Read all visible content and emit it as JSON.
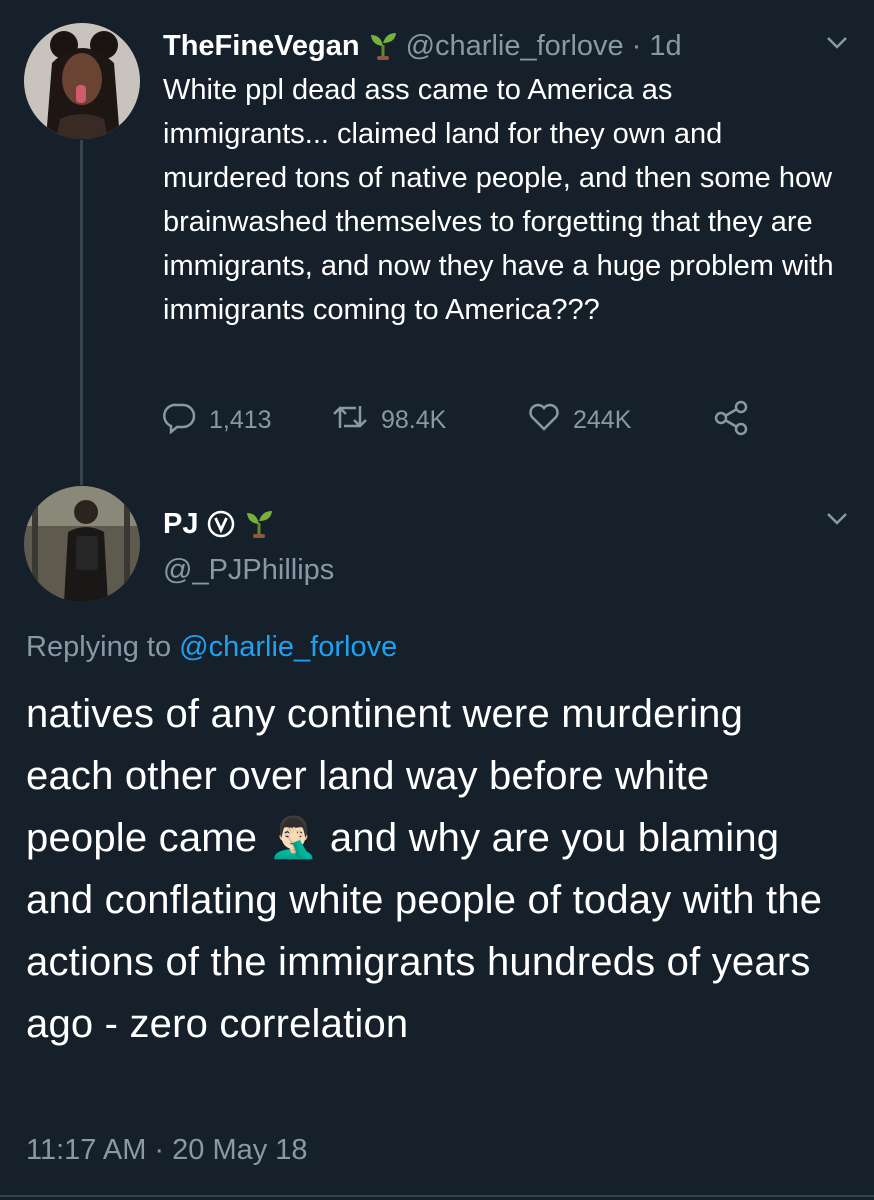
{
  "tweet1": {
    "name": "TheFineVegan",
    "handle": "@charlie_forlove",
    "sep": "·",
    "time": "1d",
    "text": "White ppl dead ass came to America as immigrants... claimed land for they own and murdered tons of native people, and then some how brainwashed themselves to forgetting that they are immigrants, and now they have a huge problem with immigrants coming to America???",
    "stats": {
      "replies": "1,413",
      "retweets": "98.4K",
      "likes": "244K"
    }
  },
  "tweet2": {
    "name": "PJ",
    "handle": "@_PJPhillips",
    "replying_prefix": "Replying to",
    "replying_handle": "@charlie_forlove",
    "text_part1": "natives of any continent were murdering each other over land way before white people came",
    "emoji": "🤦🏻‍♂️",
    "text_part2": "and why are you blaming and conflating white people of today with the actions of the immigrants hundreds of years ago - zero correlation",
    "timestamp": "11:17 AM · 20 May 18"
  },
  "colors": {
    "background": "#15202b",
    "muted": "#8899a6",
    "link": "#1da1f2",
    "divider": "#38444d"
  }
}
